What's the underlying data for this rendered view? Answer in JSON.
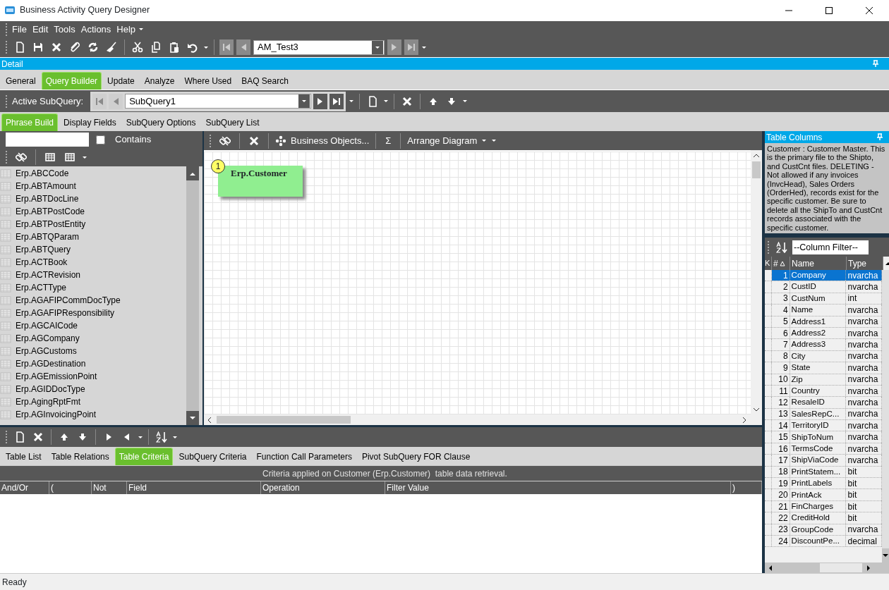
{
  "window": {
    "title": "Business Activity Query Designer"
  },
  "menu": [
    "File",
    "Edit",
    "Tools",
    "Actions",
    "Help"
  ],
  "record_field": {
    "value": "AM_Test3"
  },
  "detail_panel": {
    "title": "Detail"
  },
  "tabs": [
    {
      "label": "General",
      "selected": false
    },
    {
      "label": "Query Builder",
      "selected": true
    },
    {
      "label": "Update",
      "selected": false
    },
    {
      "label": "Analyze",
      "selected": false
    },
    {
      "label": "Where Used",
      "selected": false
    },
    {
      "label": "BAQ Search",
      "selected": false
    }
  ],
  "subquery_bar": {
    "label": "Active SubQuery:",
    "value": "SubQuery1"
  },
  "subtabs": [
    {
      "label": "Phrase Build",
      "selected": true
    },
    {
      "label": "Display Fields",
      "selected": false
    },
    {
      "label": "SubQuery Options",
      "selected": false
    },
    {
      "label": "SubQuery List",
      "selected": false
    }
  ],
  "table_search": {
    "contains_label": "Contains",
    "checked": false
  },
  "tables": [
    "Erp.ABCCode",
    "Erp.ABTAmount",
    "Erp.ABTDocLine",
    "Erp.ABTPostCode",
    "Erp.ABTPostEntity",
    "Erp.ABTQParam",
    "Erp.ABTQuery",
    "Erp.ACTBook",
    "Erp.ACTRevision",
    "Erp.ACTType",
    "Erp.AGAFIPCommDocType",
    "Erp.AGAFIPResponsibility",
    "Erp.AGCAICode",
    "Erp.AGCompany",
    "Erp.AGCustoms",
    "Erp.AGDestination",
    "Erp.AGEmissionPoint",
    "Erp.AGIDDocType",
    "Erp.AgingRptFmt",
    "Erp.AGInvoicingPoint"
  ],
  "diagram_toolbar": {
    "business_objects": "Business Objects...",
    "sum": "Σ",
    "arrange": "Arrange Diagram"
  },
  "diagram_nodes": [
    {
      "number": "1",
      "label": "Erp.Customer"
    }
  ],
  "bottom_tabs": [
    {
      "label": "Table List",
      "selected": false
    },
    {
      "label": "Table Relations",
      "selected": false
    },
    {
      "label": "Table Criteria",
      "selected": true
    },
    {
      "label": "SubQuery Criteria",
      "selected": false
    },
    {
      "label": "Function Call Parameters",
      "selected": false
    },
    {
      "label": "Pivot SubQuery FOR Clause",
      "selected": false
    }
  ],
  "criteria": {
    "caption": "Criteria applied on Customer (Erp.Customer)  table data retrieval.",
    "columns": [
      "And/Or",
      "(",
      "Not",
      "Field",
      "Operation",
      "Filter Value",
      ")"
    ]
  },
  "table_columns_panel": {
    "title": "Table Columns",
    "description": "Customer : Customer Master. This is the primary file to the Shipto, and CustCnt files. DELETING - Not allowed if any invoices (InvcHead), Sales Orders (OrderHed), records exist for the specific customer. Be sure to delete all the ShipTo and CustCnt records associated with the specific customer.",
    "filter_value": "--Column Filter--",
    "columns": [
      "K",
      "#",
      "Name",
      "Type"
    ],
    "rows": [
      {
        "num": "1",
        "name": "Company",
        "type": "nvarcha",
        "selected": true
      },
      {
        "num": "2",
        "name": "CustID",
        "type": "nvarcha",
        "selected": false
      },
      {
        "num": "3",
        "name": "CustNum",
        "type": "int",
        "selected": false
      },
      {
        "num": "4",
        "name": "Name",
        "type": "nvarcha",
        "selected": false
      },
      {
        "num": "5",
        "name": "Address1",
        "type": "nvarcha",
        "selected": false
      },
      {
        "num": "6",
        "name": "Address2",
        "type": "nvarcha",
        "selected": false
      },
      {
        "num": "7",
        "name": "Address3",
        "type": "nvarcha",
        "selected": false
      },
      {
        "num": "8",
        "name": "City",
        "type": "nvarcha",
        "selected": false
      },
      {
        "num": "9",
        "name": "State",
        "type": "nvarcha",
        "selected": false
      },
      {
        "num": "10",
        "name": "Zip",
        "type": "nvarcha",
        "selected": false
      },
      {
        "num": "11",
        "name": "Country",
        "type": "nvarcha",
        "selected": false
      },
      {
        "num": "12",
        "name": "ResaleID",
        "type": "nvarcha",
        "selected": false
      },
      {
        "num": "13",
        "name": "SalesRepC...",
        "type": "nvarcha",
        "selected": false
      },
      {
        "num": "14",
        "name": "TerritoryID",
        "type": "nvarcha",
        "selected": false
      },
      {
        "num": "15",
        "name": "ShipToNum",
        "type": "nvarcha",
        "selected": false
      },
      {
        "num": "16",
        "name": "TermsCode",
        "type": "nvarcha",
        "selected": false
      },
      {
        "num": "17",
        "name": "ShipViaCode",
        "type": "nvarcha",
        "selected": false
      },
      {
        "num": "18",
        "name": "PrintStatem...",
        "type": "bit",
        "selected": false
      },
      {
        "num": "19",
        "name": "PrintLabels",
        "type": "bit",
        "selected": false
      },
      {
        "num": "20",
        "name": "PrintAck",
        "type": "bit",
        "selected": false
      },
      {
        "num": "21",
        "name": "FinCharges",
        "type": "bit",
        "selected": false
      },
      {
        "num": "22",
        "name": "CreditHold",
        "type": "bit",
        "selected": false
      },
      {
        "num": "23",
        "name": "GroupCode",
        "type": "nvarcha",
        "selected": false
      },
      {
        "num": "24",
        "name": "DiscountPe...",
        "type": "decimal",
        "selected": false
      }
    ]
  },
  "status_bar": "Ready"
}
